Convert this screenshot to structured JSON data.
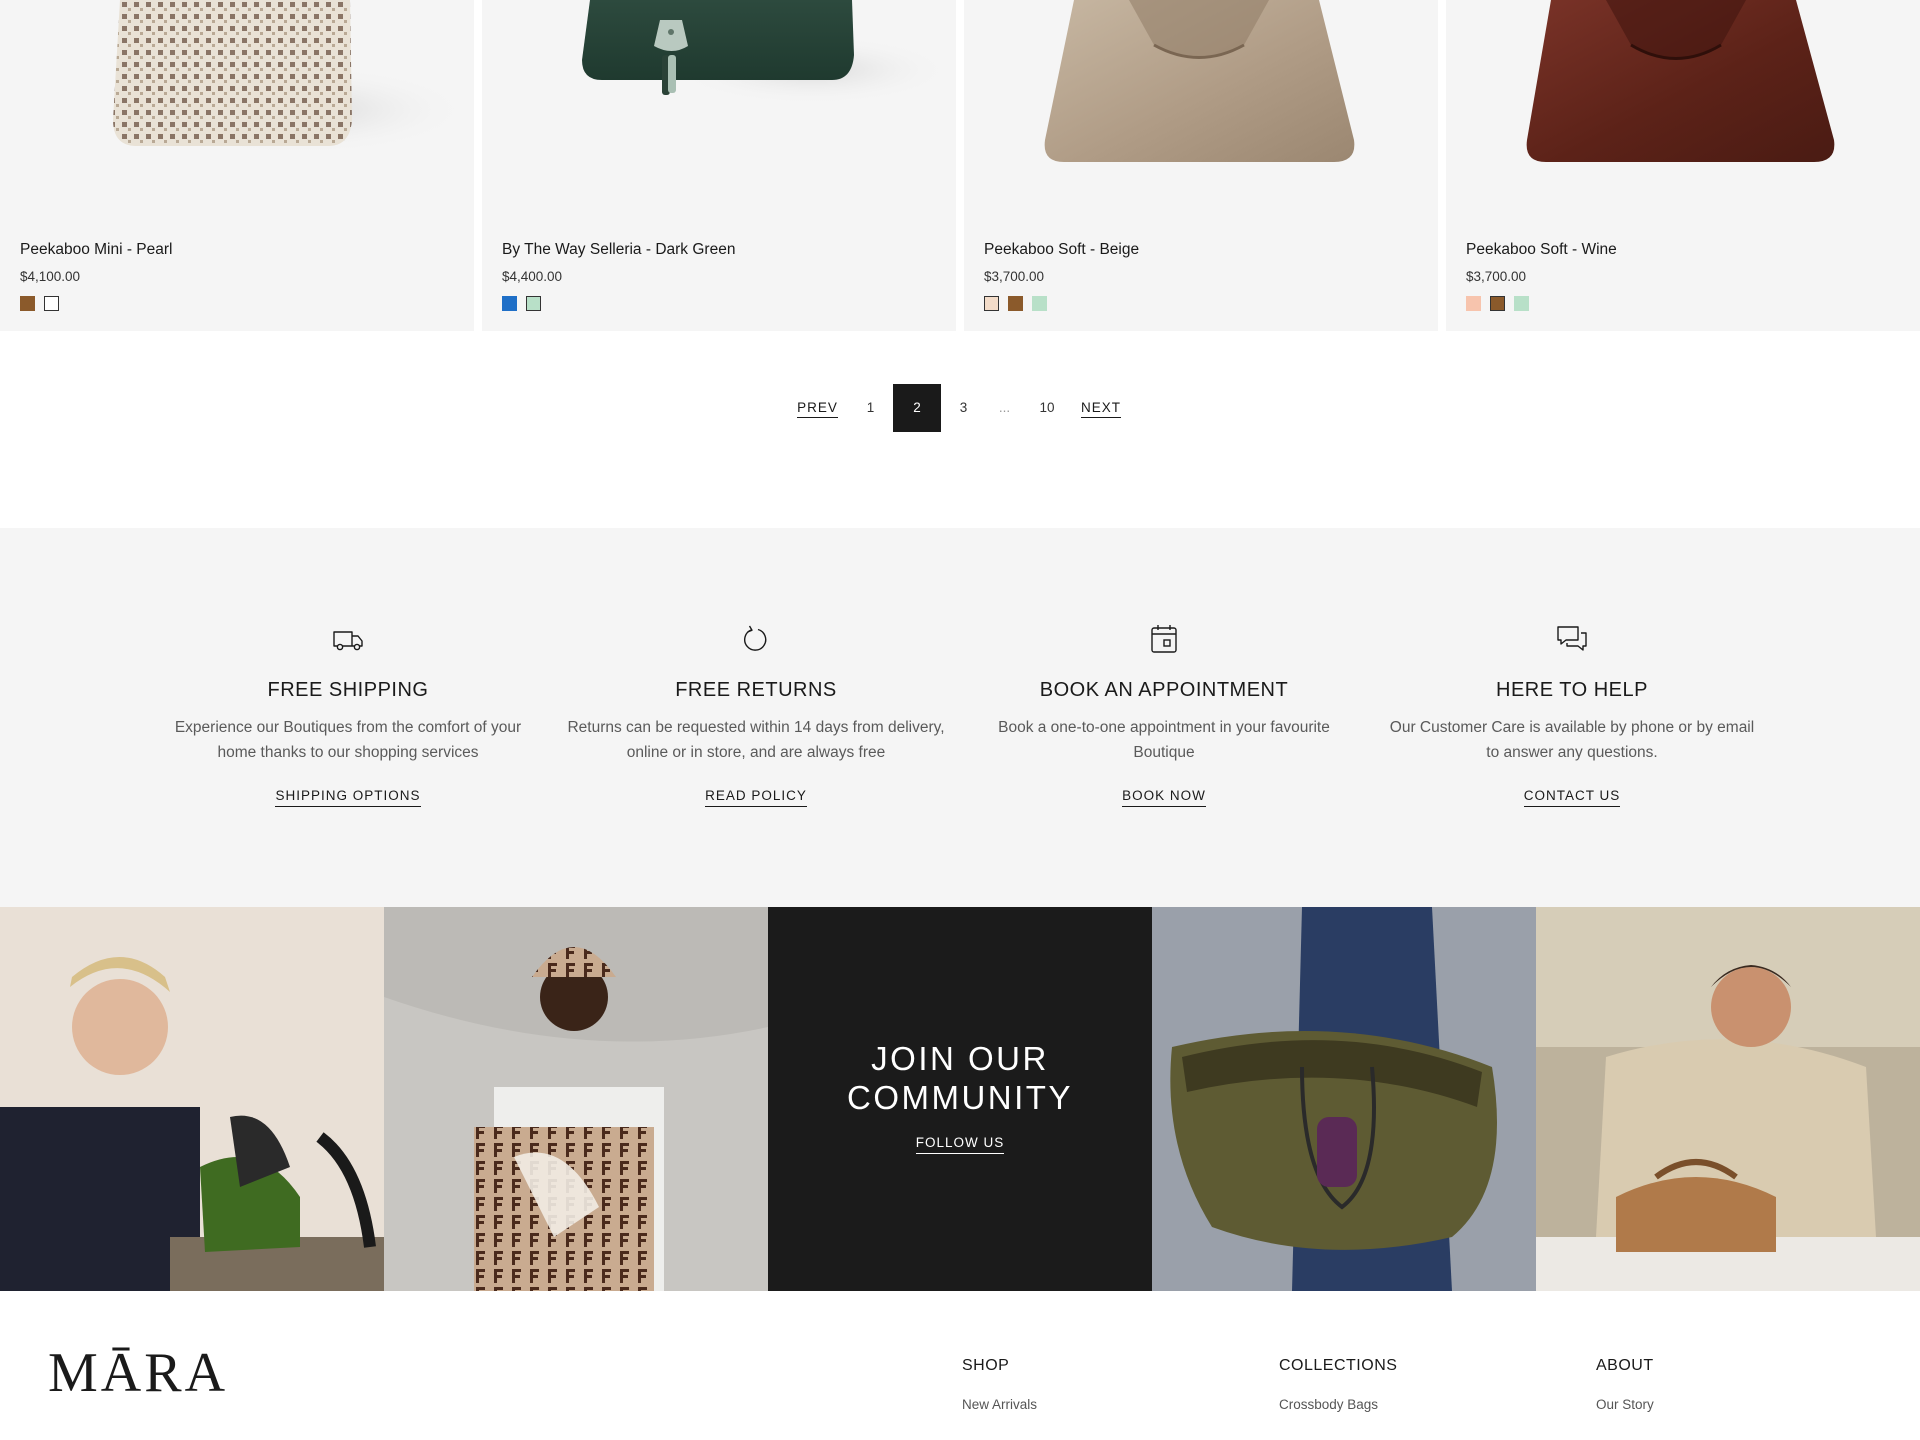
{
  "products": [
    {
      "name": "Peekaboo Mini - Pearl",
      "price": "$4,100.00",
      "swatches": [
        "#8b5a2b",
        "#ffffff"
      ],
      "image": "woven-cream-bag"
    },
    {
      "name": "By The Way Selleria - Dark Green",
      "price": "$4,400.00",
      "swatches": [
        "#1f6fc7",
        "#b8e0c8"
      ],
      "image": "dark-green-bag"
    },
    {
      "name": "Peekaboo Soft - Beige",
      "price": "$3,700.00",
      "swatches": [
        "#f3dcc9",
        "#8b5a2b",
        "#b8e0c8"
      ],
      "image": "beige-leather-bag"
    },
    {
      "name": "Peekaboo Soft - Wine",
      "price": "$3,700.00",
      "swatches": [
        "#f7c4ad",
        "#8b5a2b",
        "#b8e0c8"
      ],
      "image": "wine-leather-bag"
    }
  ],
  "pagination": {
    "prev": "PREV",
    "pages": [
      "1",
      "2",
      "3",
      "...",
      "10"
    ],
    "active": "2",
    "next": "NEXT"
  },
  "services": [
    {
      "icon": "truck-icon",
      "title": "FREE SHIPPING",
      "desc": "Experience our Boutiques from the comfort of your home thanks to our shopping services",
      "cta": "SHIPPING OPTIONS"
    },
    {
      "icon": "refresh-icon",
      "title": "FREE RETURNS",
      "desc": "Returns can be requested within 14 days from delivery, online or in store, and are always free",
      "cta": "READ POLICY"
    },
    {
      "icon": "calendar-icon",
      "title": "BOOK AN APPOINTMENT",
      "desc": "Book a one-to-one appointment in your favourite Boutique",
      "cta": "BOOK NOW"
    },
    {
      "icon": "chat-icon",
      "title": "HERE TO HELP",
      "desc": "Our Customer Care is available by phone or by email to answer any questions.",
      "cta": "CONTACT US"
    }
  ],
  "community": {
    "title_line1": "JOIN OUR",
    "title_line2": "COMMUNITY",
    "cta": "FOLLOW US"
  },
  "footer": {
    "logo": "MĀRA",
    "columns": [
      {
        "head": "SHOP",
        "items": [
          "New Arrivals"
        ]
      },
      {
        "head": "COLLECTIONS",
        "items": [
          "Crossbody Bags"
        ]
      },
      {
        "head": "ABOUT",
        "items": [
          "Our Story"
        ]
      }
    ]
  },
  "colors": {
    "background": "#ffffff",
    "panel": "#f5f5f5",
    "ink": "#1a1a1a",
    "muted": "#5a5a5a",
    "dark_tile": "#1b1b1b"
  }
}
